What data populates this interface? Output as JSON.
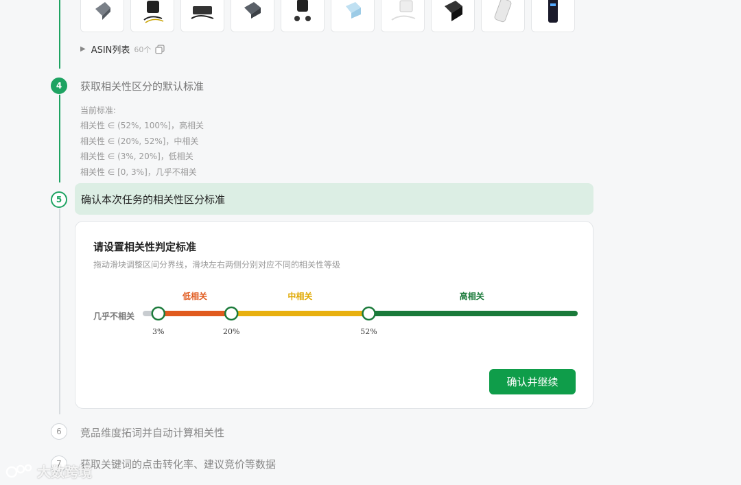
{
  "thumbnails": [
    {
      "icon": "charger-gray-icon"
    },
    {
      "icon": "charger-black-cable-icon"
    },
    {
      "icon": "laptop-adapter-icon"
    },
    {
      "icon": "charger-dark-gray-icon"
    },
    {
      "icon": "travel-adapter-icon"
    },
    {
      "icon": "charger-blue-icon"
    },
    {
      "icon": "charger-white-kit-icon"
    },
    {
      "icon": "charger-black-icon"
    },
    {
      "icon": "power-bank-white-icon"
    },
    {
      "icon": "power-bank-black-icon"
    }
  ],
  "asin": {
    "label": "ASIN列表",
    "count": "60个"
  },
  "step4": {
    "number": "4",
    "title": "获取相关性区分的默认标准",
    "criteria_header": "当前标准:",
    "criteria": [
      "相关性 ∈ (52%, 100%]，高相关",
      "相关性 ∈ (20%, 52%]，中相关",
      "相关性 ∈ (3%, 20%]，低相关",
      "相关性 ∈ [0, 3%]，几乎不相关"
    ]
  },
  "step5": {
    "number": "5",
    "title": "确认本次任务的相关性区分标准",
    "card_title": "请设置相关性判定标准",
    "card_subtitle": "拖动滑块调整区间分界线，滑块左右两侧分别对应不同的相关性等级",
    "none_label": "几乎不相关",
    "segments": {
      "low": "低相关",
      "mid": "中相关",
      "high": "高相关"
    },
    "thresholds": [
      3,
      20,
      52
    ],
    "threshold_labels": [
      "3%",
      "20%",
      "52%"
    ],
    "confirm_label": "确认并继续"
  },
  "step6": {
    "number": "6",
    "title": "竞品维度拓词并自动计算相关性"
  },
  "step7": {
    "number": "7",
    "title": "获取关键词的点击转化率、建议竞价等数据"
  },
  "colors": {
    "accent": "#1ea362",
    "low": "#e05a1e",
    "mid": "#e8b00f",
    "high": "#1a7a3a",
    "button": "#0f9d4a"
  },
  "watermark": "大数跨境"
}
